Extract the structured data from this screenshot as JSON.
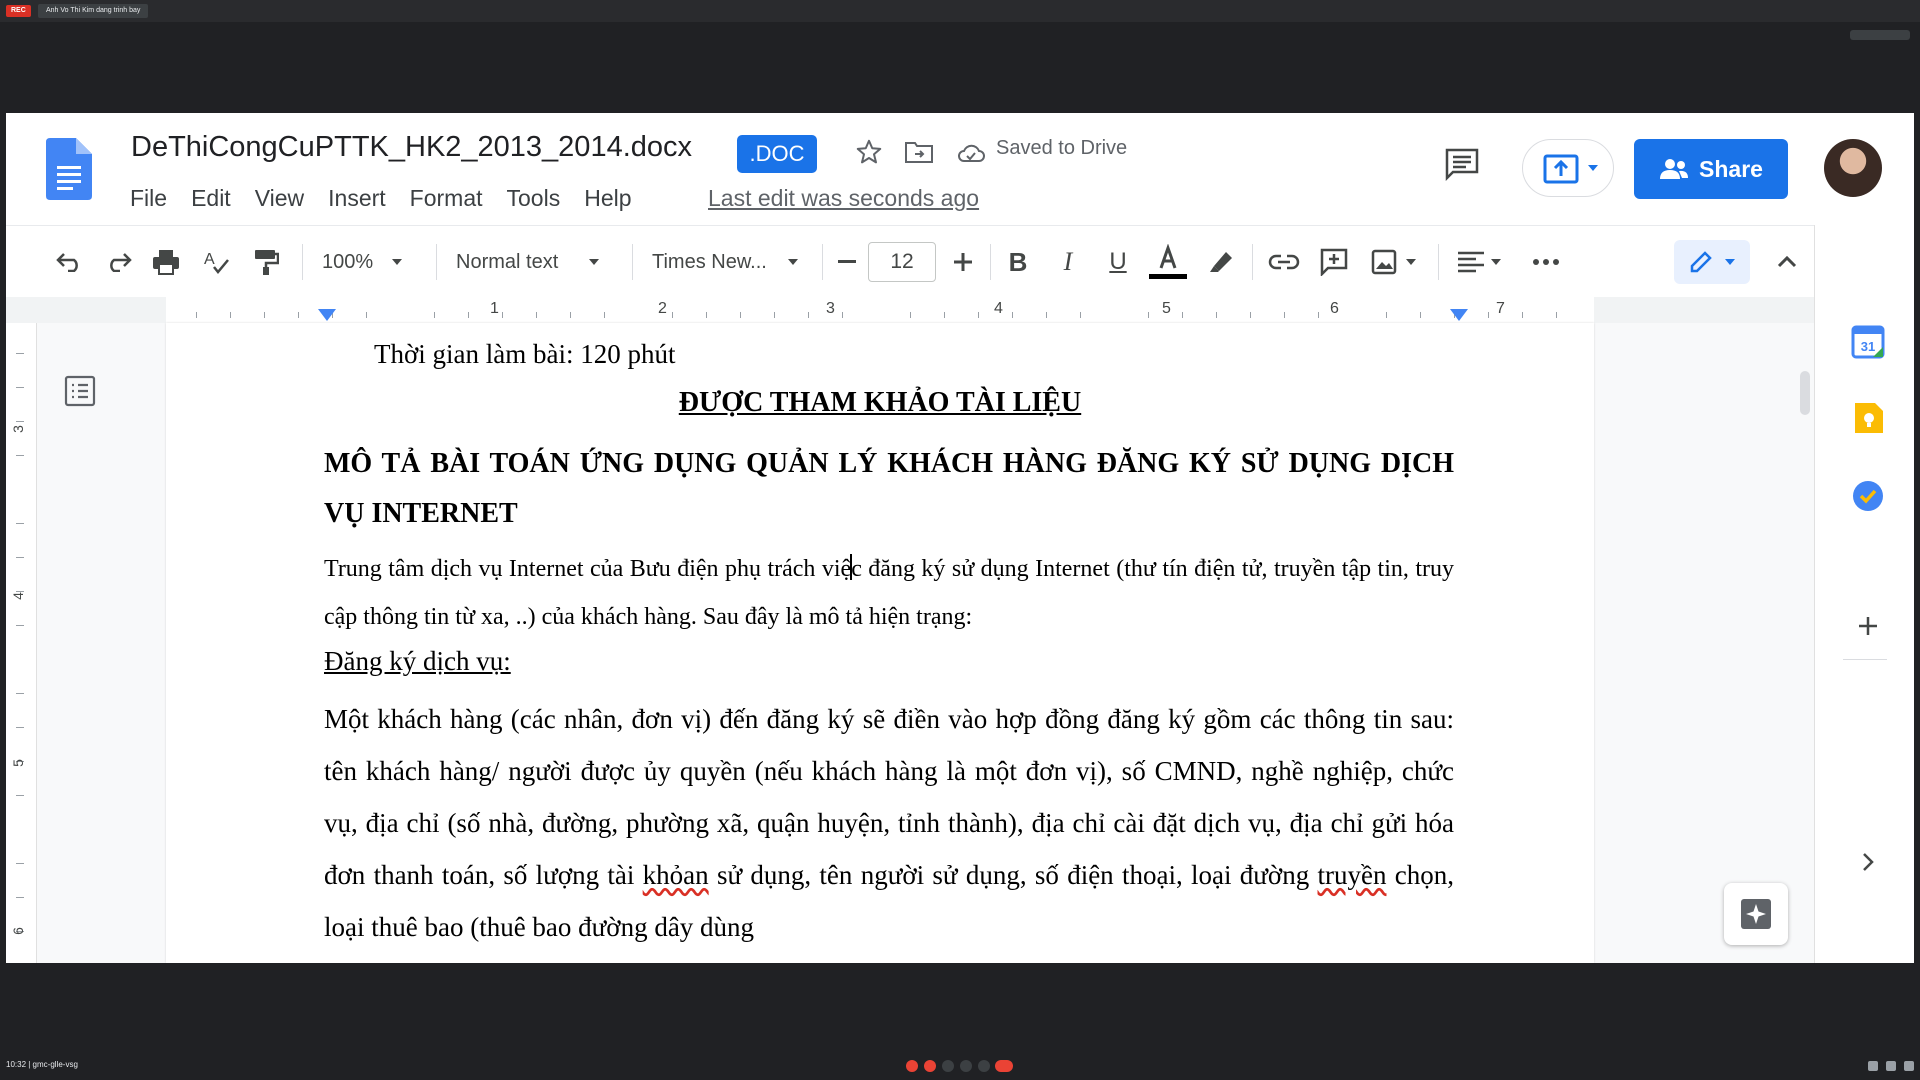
{
  "meet": {
    "rec_label": "REC",
    "tab_label": "Anh Vo Thi Kim dang trinh bay",
    "clock": "10:32 | gmc-glle-vsg"
  },
  "header": {
    "title": "DeThiCongCuPTTK_HK2_2013_2014.docx",
    "badge": ".DOC",
    "saved_status": "Saved to Drive",
    "last_edit": "Last edit was seconds ago",
    "share_label": "Share"
  },
  "menu": [
    "File",
    "Edit",
    "View",
    "Insert",
    "Format",
    "Tools",
    "Help"
  ],
  "toolbar": {
    "zoom": "100%",
    "style": "Normal text",
    "font": "Times New...",
    "font_size": "12"
  },
  "ruler": {
    "horizontal_numbers": [
      "1",
      "2",
      "3",
      "4",
      "5",
      "6",
      "7"
    ],
    "vertical_numbers": [
      "3",
      "4",
      "5",
      "6"
    ]
  },
  "document": {
    "time_line": "Thời gian làm bài: 120 phút",
    "heading_ref": "ĐƯỢC THAM KHẢO TÀI LIỆU",
    "heading_main": "MÔ TẢ BÀI TOÁN ỨNG DỤNG QUẢN LÝ KHÁCH HÀNG ĐĂNG KÝ SỬ DỤNG DỊCH VỤ INTERNET",
    "intro_before_cursor": "Trung tâm dịch vụ Internet của Bưu điện phụ trách việ",
    "intro_after_cursor": "c đăng ký sử dụng Internet (thư tín điện tử, truyền tập tin, truy cập thông tin từ xa, ..) của khách hàng. Sau đây là mô tả hiện trạng:",
    "section_dangky": "Đăng ký dịch vụ:",
    "body_1": "Một khách hàng (các nhân, đơn vị) đến đăng ký sẽ điền vào hợp đồng đăng ký gồm các thông tin sau: tên khách hàng/ người được ủy quyền (nếu khách hàng là một đơn vị), số CMND, nghề nghiệp, chức vụ, địa chỉ (số nhà, đường, phường xã, quận huyện, tỉnh thành), địa chỉ cài đặt dịch vụ, địa chỉ gửi hóa đơn thanh toán, số lượng tài ",
    "body_spell_1": "khỏan",
    "body_2": " sử dụng, tên người sử dụng, số điện thoại, loại đường ",
    "body_spell_2": "truyền",
    "body_3": " chọn, loại thuê bao (thuê bao đường dây dùng"
  },
  "colors": {
    "accent": "#1a73e8",
    "doc_blue": "#4285f4",
    "spell_error": "#d93025"
  },
  "icons": [
    "docs-logo-icon",
    "star-icon",
    "move-to-folder-icon",
    "cloud-saved-icon",
    "comments-icon",
    "present-icon",
    "undo-icon",
    "redo-icon",
    "print-icon",
    "spellcheck-icon",
    "paint-format-icon",
    "bold-icon",
    "italic-icon",
    "underline-icon",
    "text-color-icon",
    "highlight-icon",
    "link-icon",
    "add-comment-icon",
    "insert-image-icon",
    "align-icon",
    "more-icon",
    "editing-mode-icon",
    "collapse-icon",
    "outline-icon",
    "calendar-icon",
    "keep-icon",
    "tasks-icon",
    "add-icon",
    "expand-panel-icon",
    "explore-icon"
  ]
}
